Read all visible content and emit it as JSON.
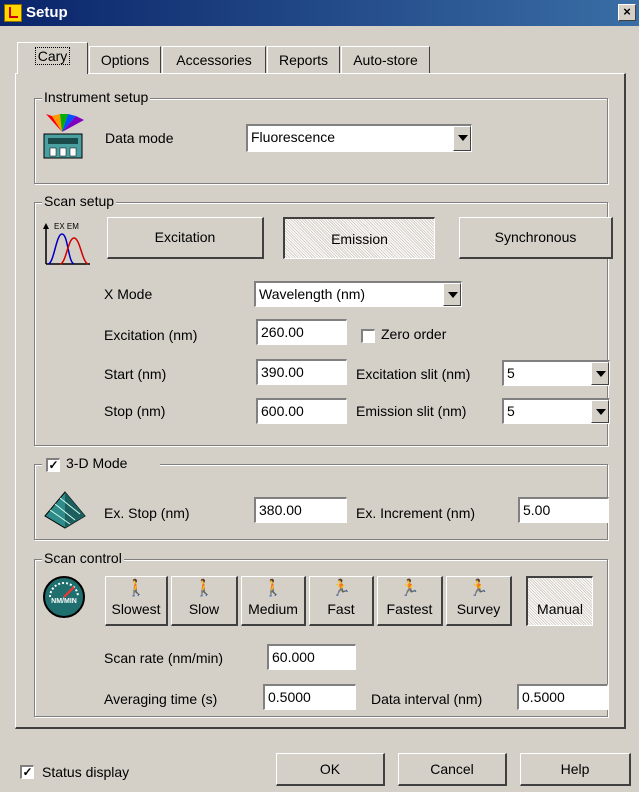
{
  "window": {
    "title": "Setup",
    "close_glyph": "×"
  },
  "tabs": [
    {
      "label": "Cary",
      "active": true
    },
    {
      "label": "Options"
    },
    {
      "label": "Accessories"
    },
    {
      "label": "Reports"
    },
    {
      "label": "Auto-store"
    }
  ],
  "instrument_setup": {
    "legend": "Instrument setup",
    "data_mode_label": "Data mode",
    "data_mode_value": "Fluorescence"
  },
  "scan_setup": {
    "legend": "Scan setup",
    "icon_text": "EX EM",
    "buttons": {
      "excitation": "Excitation",
      "emission": "Emission",
      "synchronous": "Synchronous"
    },
    "selected_mode": "Emission",
    "xmode_label": "X Mode",
    "xmode_value": "Wavelength (nm)",
    "excitation_label": "Excitation (nm)",
    "excitation_value": "260.00",
    "zero_order_label": "Zero order",
    "zero_order_checked": false,
    "start_label": "Start (nm)",
    "start_value": "390.00",
    "excitation_slit_label": "Excitation slit (nm)",
    "excitation_slit_value": "5",
    "stop_label": "Stop (nm)",
    "stop_value": "600.00",
    "emission_slit_label": "Emission slit (nm)",
    "emission_slit_value": "5"
  },
  "mode_3d": {
    "label": "3-D Mode",
    "checked": true,
    "check_glyph": "✓",
    "ex_stop_label": "Ex. Stop (nm)",
    "ex_stop_value": "380.00",
    "ex_increment_label": "Ex. Increment (nm)",
    "ex_increment_value": "5.00"
  },
  "scan_control": {
    "legend": "Scan control",
    "icon_text": "NM/MIN",
    "speeds": [
      {
        "label": "Slowest",
        "glyph": "🚶"
      },
      {
        "label": "Slow",
        "glyph": "🚶"
      },
      {
        "label": "Medium",
        "glyph": "🚶"
      },
      {
        "label": "Fast",
        "glyph": "🏃"
      },
      {
        "label": "Fastest",
        "glyph": "🏃"
      },
      {
        "label": "Survey",
        "glyph": "🏃"
      }
    ],
    "manual_label": "Manual",
    "selected_speed": "Manual",
    "scan_rate_label": "Scan rate (nm/min)",
    "scan_rate_value": "60.000",
    "averaging_time_label": "Averaging time (s)",
    "averaging_time_value": "0.5000",
    "data_interval_label": "Data interval (nm)",
    "data_interval_value": "0.5000"
  },
  "footer": {
    "status_display_label": "Status display",
    "status_display_checked": true,
    "ok_label": "OK",
    "cancel_label": "Cancel",
    "help_label": "Help"
  },
  "colors": {
    "title_bar": "#0a246a",
    "face": "#d4d0c8"
  }
}
